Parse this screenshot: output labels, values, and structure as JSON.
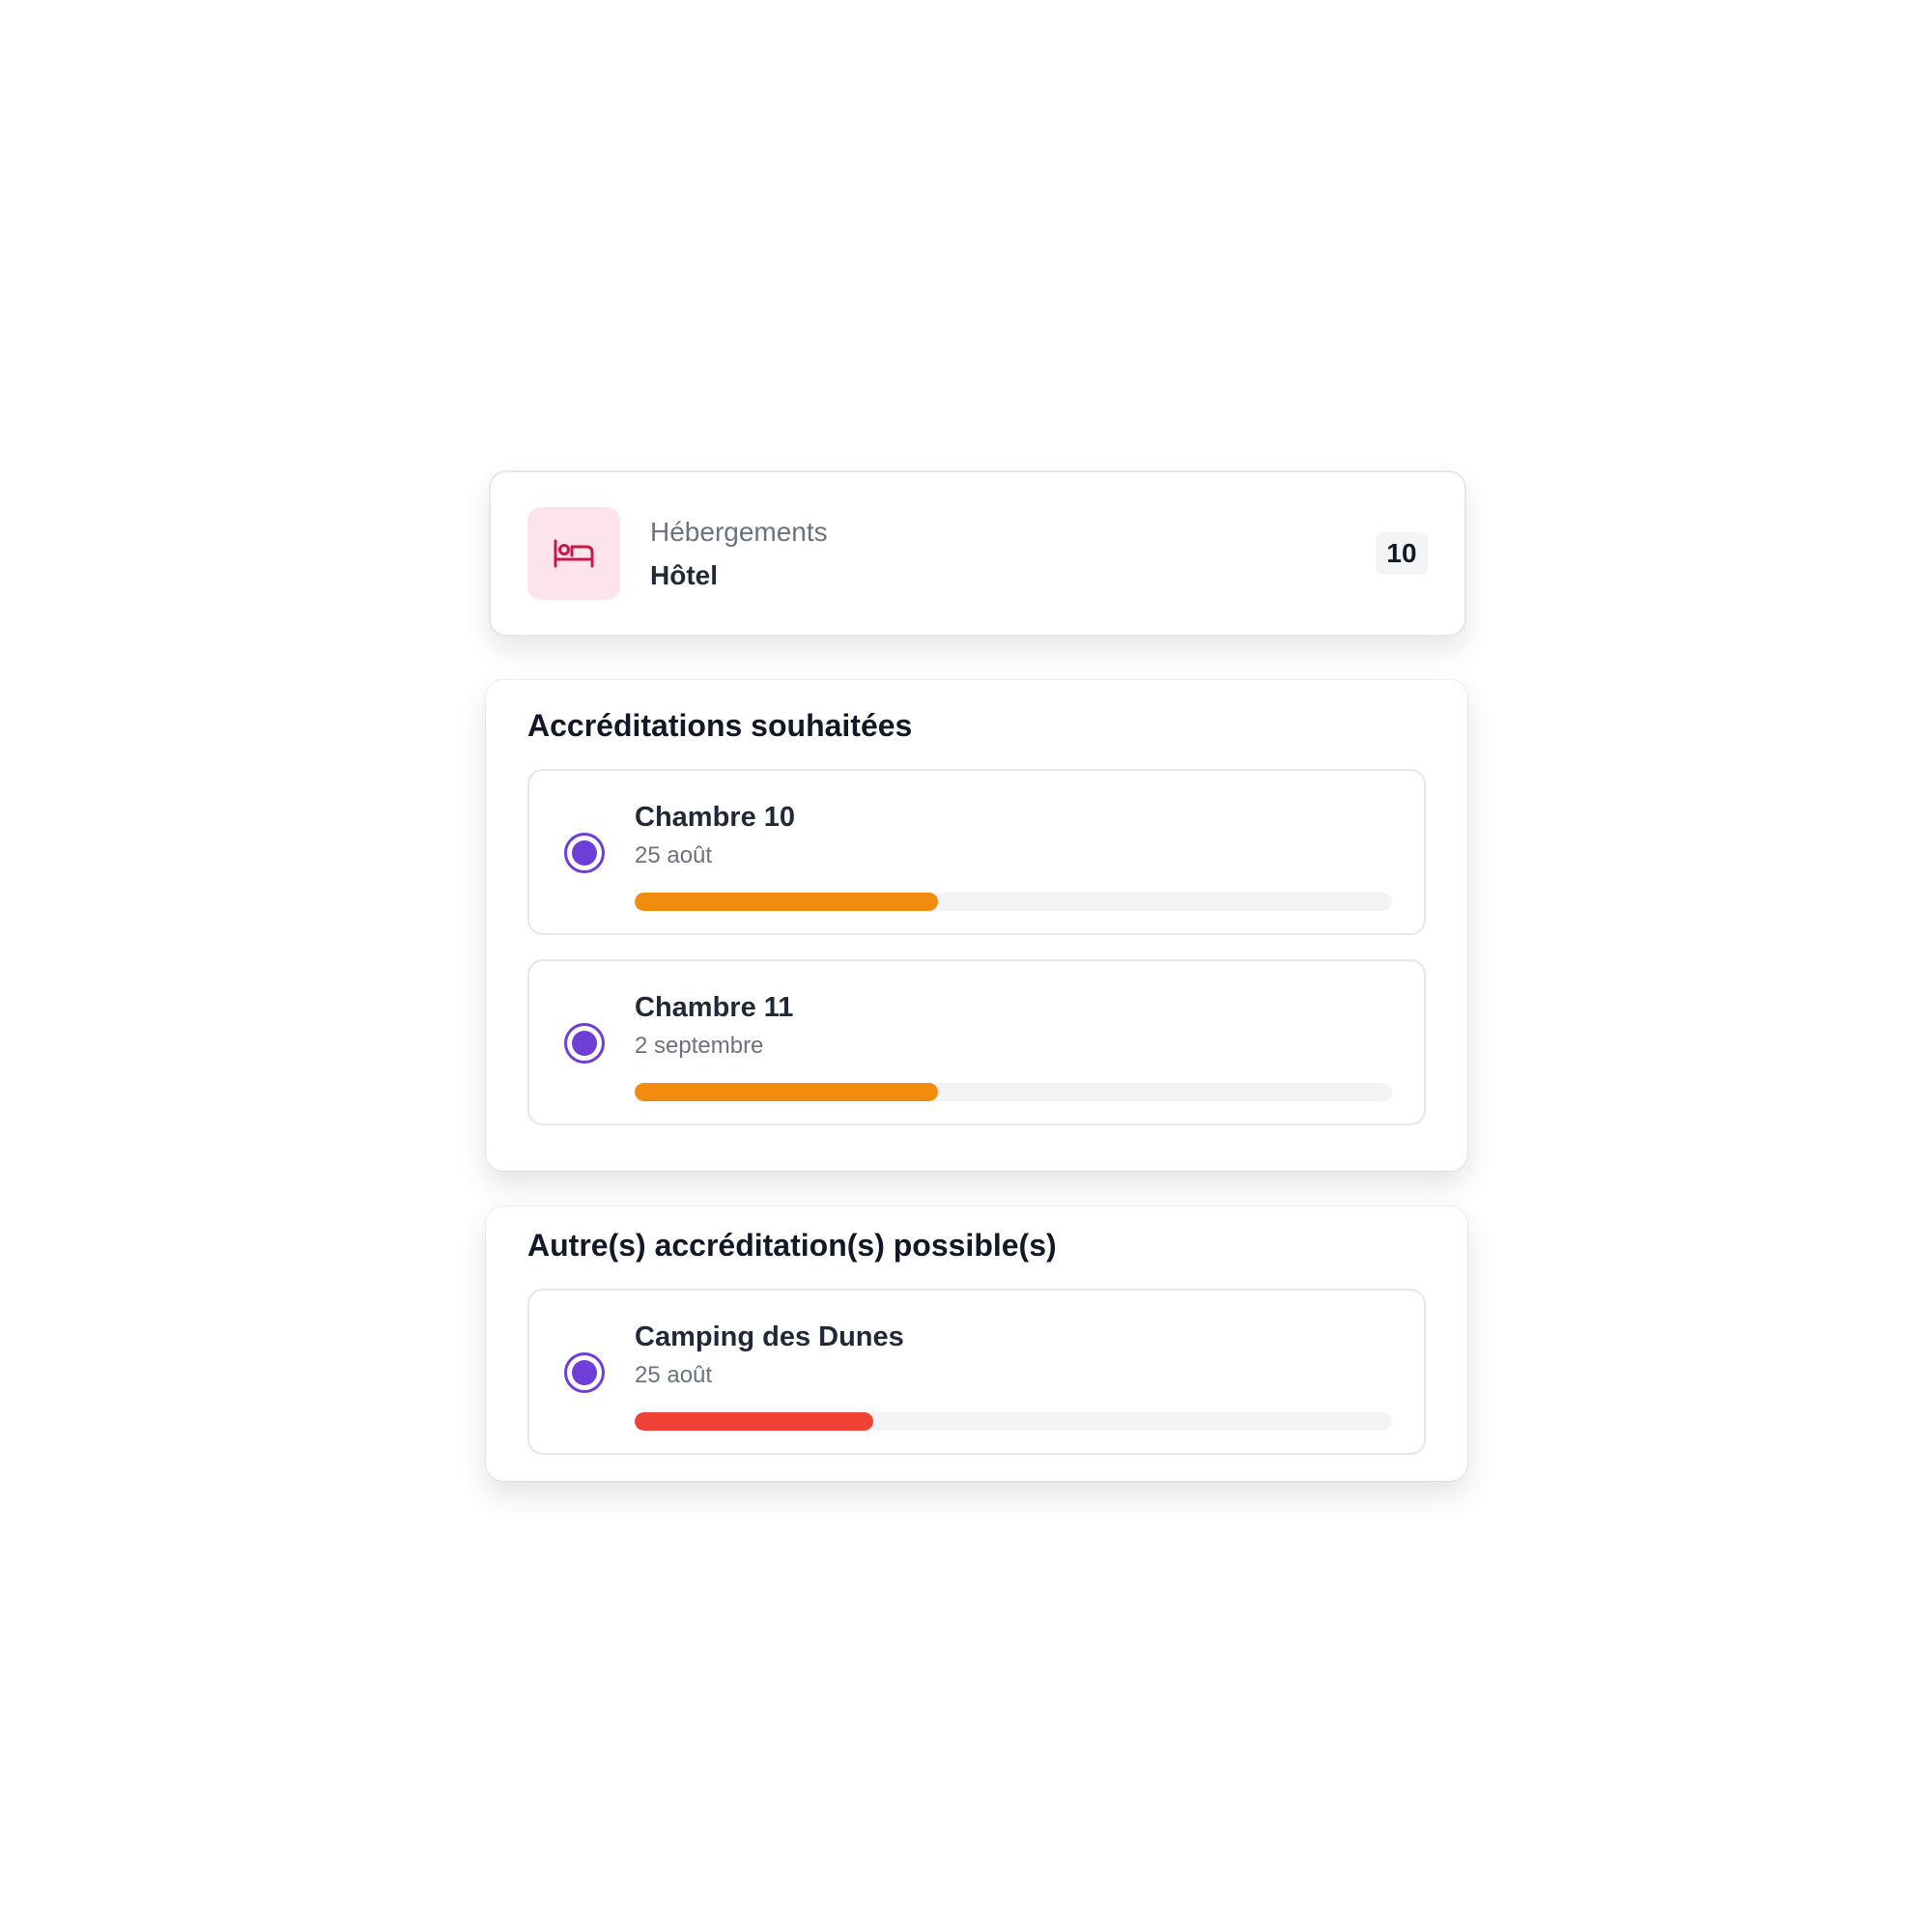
{
  "header": {
    "icon": "bed-icon",
    "category": "Hébergements",
    "title": "Hôtel",
    "count": "10",
    "icon_color": "#c8174a",
    "icon_bg": "#fde4ea"
  },
  "sections": [
    {
      "title": "Accréditations souhaitées",
      "items": [
        {
          "title": "Chambre 10",
          "date": "25 août",
          "progress": 0.4,
          "color": "#f28c0f"
        },
        {
          "title": "Chambre 11",
          "date": "2 septembre",
          "progress": 0.4,
          "color": "#f28c0f"
        }
      ]
    },
    {
      "title": "Autre(s) accréditation(s) possible(s)",
      "items": [
        {
          "title": "Camping des Dunes",
          "date": "25 août",
          "progress": 0.315,
          "color": "#ef4135"
        }
      ]
    }
  ],
  "colors": {
    "accent": "#6d3fd6",
    "track": "#f3f4f6"
  }
}
